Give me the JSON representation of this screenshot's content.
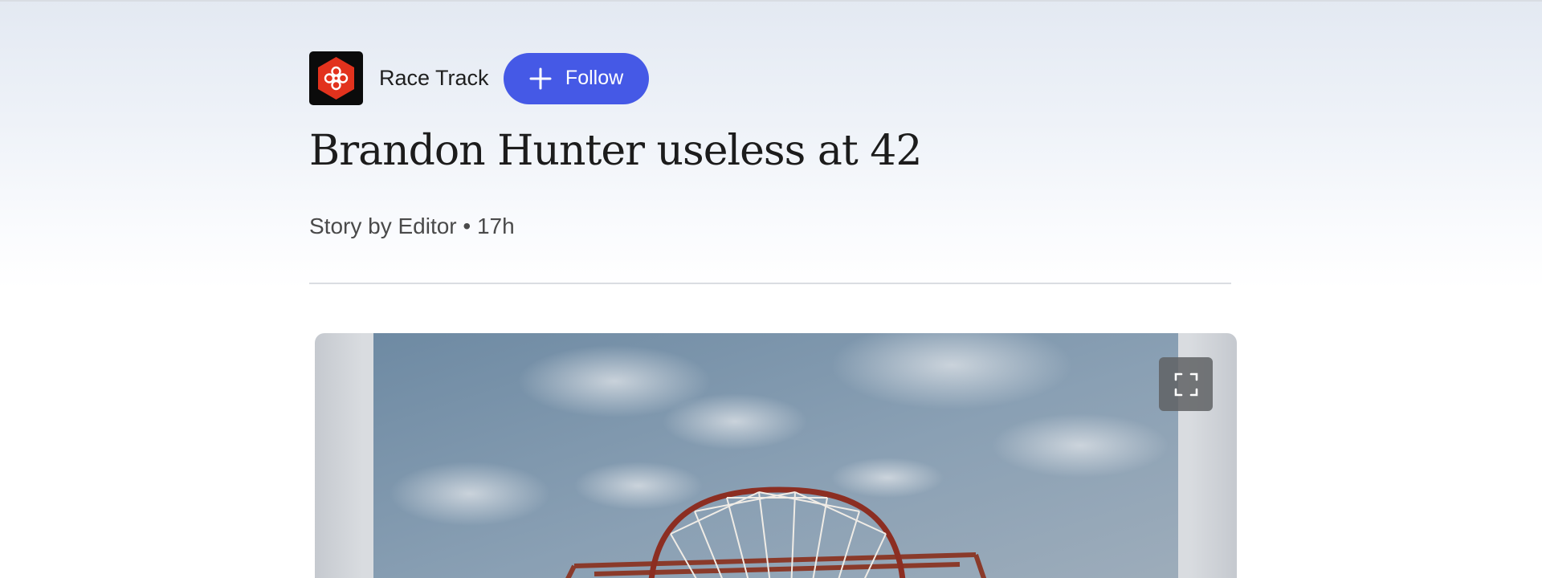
{
  "source": {
    "name": "Race Track",
    "logo_icon": "hexagon-knot-logo-icon",
    "follow_label": "Follow",
    "follow_icon": "plus-icon"
  },
  "article": {
    "headline": "Brandon Hunter useless at 42",
    "byline": "Story by Editor • 17h"
  },
  "hero": {
    "image_icon": "basketball-hoop-photo",
    "expand_icon": "expand-fullscreen-icon"
  },
  "colors": {
    "follow_button": "#4559e6",
    "logo_red": "#e2321d",
    "page_top_tint": "#e3e9f2"
  }
}
